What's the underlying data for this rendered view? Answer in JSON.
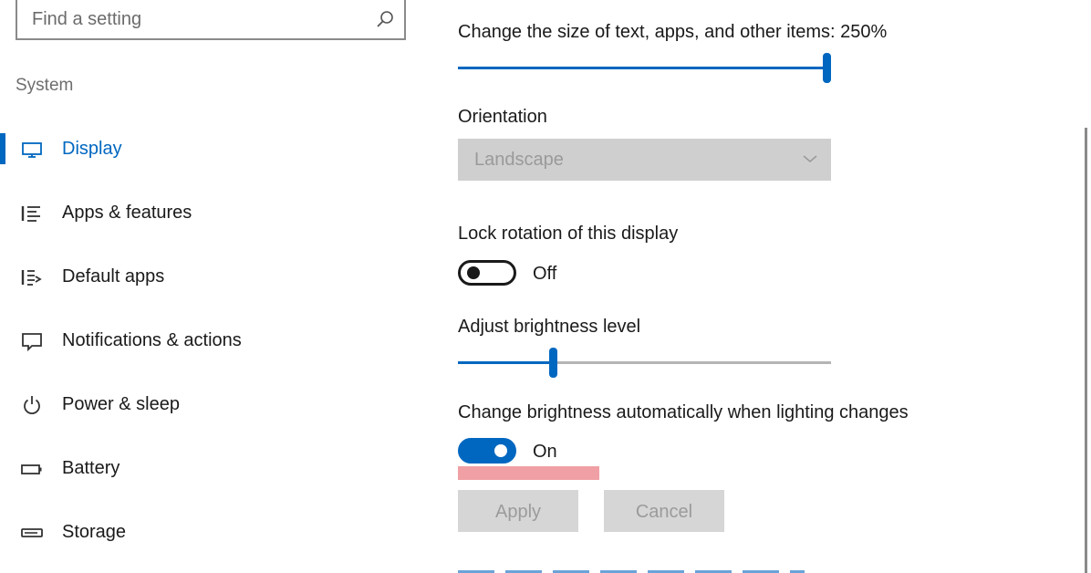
{
  "search": {
    "placeholder": "Find a setting",
    "icon": "search-icon"
  },
  "sidebar": {
    "section_label": "System",
    "active_index": 0,
    "items": [
      {
        "label": "Display",
        "icon": "monitor-icon",
        "active": true
      },
      {
        "label": "Apps & features",
        "icon": "apps-list-icon",
        "active": false
      },
      {
        "label": "Default apps",
        "icon": "default-apps-icon",
        "active": false
      },
      {
        "label": "Notifications & actions",
        "icon": "notification-icon",
        "active": false
      },
      {
        "label": "Power & sleep",
        "icon": "power-icon",
        "active": false
      },
      {
        "label": "Battery",
        "icon": "battery-icon",
        "active": false
      },
      {
        "label": "Storage",
        "icon": "storage-icon",
        "active": false
      }
    ]
  },
  "main": {
    "scale": {
      "label": "Change the size of text, apps, and other items: 250%",
      "slider_fraction": 1.0
    },
    "orientation": {
      "label": "Orientation",
      "selected": "Landscape",
      "disabled": true
    },
    "lock_rotation": {
      "label": "Lock rotation of this display",
      "state": "Off",
      "on": false
    },
    "brightness": {
      "label": "Adjust brightness level",
      "slider_fraction": 0.25
    },
    "auto_brightness": {
      "label": "Change brightness automatically when lighting changes",
      "state": "On",
      "on": true
    },
    "buttons": {
      "apply": "Apply",
      "cancel": "Cancel"
    }
  },
  "colors": {
    "accent": "#0067c0",
    "disabled_bg": "#d6d6d6",
    "highlight": "#f0a0a4"
  }
}
